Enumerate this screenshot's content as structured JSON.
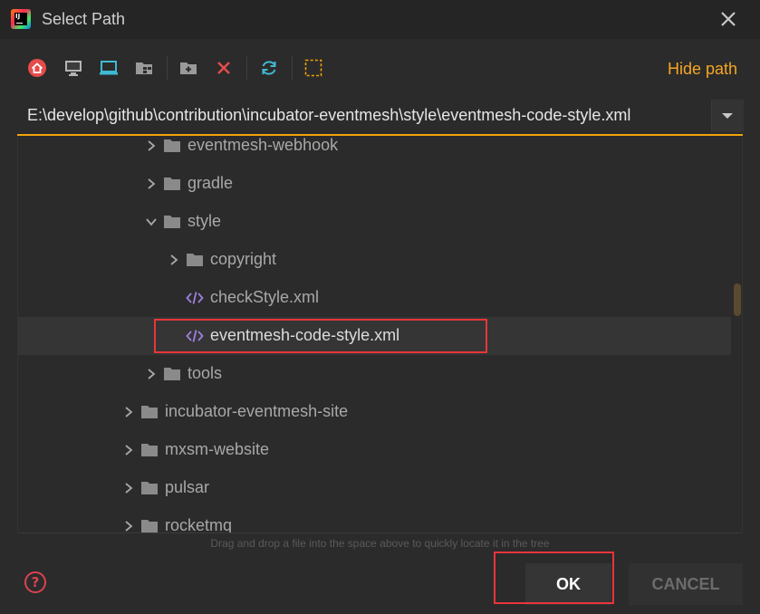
{
  "window": {
    "title": "Select Path",
    "logo_text": "IJ"
  },
  "toolbar": {
    "icons": [
      "home-icon",
      "desktop-icon",
      "laptop-icon",
      "module-folder-icon",
      "new-folder-icon",
      "delete-icon",
      "refresh-icon",
      "show-hidden-icon"
    ],
    "hide_path_label": "Hide path"
  },
  "path": {
    "value": "E:\\develop\\github\\contribution\\incubator-eventmesh\\style\\eventmesh-code-style.xml"
  },
  "tree": {
    "items": [
      {
        "label": "eventmesh-webhook",
        "type": "folder",
        "depth": 2,
        "expanded": false,
        "selected": false
      },
      {
        "label": "gradle",
        "type": "folder",
        "depth": 2,
        "expanded": false,
        "selected": false
      },
      {
        "label": "style",
        "type": "folder",
        "depth": 2,
        "expanded": true,
        "selected": false
      },
      {
        "label": "copyright",
        "type": "folder",
        "depth": 3,
        "expanded": false,
        "selected": false
      },
      {
        "label": "checkStyle.xml",
        "type": "xml",
        "depth": 3,
        "selected": false
      },
      {
        "label": "eventmesh-code-style.xml",
        "type": "xml",
        "depth": 3,
        "selected": true
      },
      {
        "label": "tools",
        "type": "folder",
        "depth": 2,
        "expanded": false,
        "selected": false
      },
      {
        "label": "incubator-eventmesh-site",
        "type": "folder",
        "depth": 1,
        "expanded": false,
        "selected": false
      },
      {
        "label": "mxsm-website",
        "type": "folder",
        "depth": 1,
        "expanded": false,
        "selected": false
      },
      {
        "label": "pulsar",
        "type": "folder",
        "depth": 1,
        "expanded": false,
        "selected": false
      },
      {
        "label": "rocketmq",
        "type": "folder",
        "depth": 1,
        "expanded": false,
        "selected": false
      }
    ]
  },
  "hint": "Drag and drop a file into the space above to quickly locate it in the tree",
  "buttons": {
    "ok": "OK",
    "cancel": "CANCEL",
    "help": "?"
  },
  "colors": {
    "accent": "#f0a30a",
    "hide_path": "#f5a623",
    "highlight_box": "#e8353b",
    "help": "#d9434f",
    "folder": "#8a8a8a",
    "xml_icon": "#9f7fe0"
  }
}
